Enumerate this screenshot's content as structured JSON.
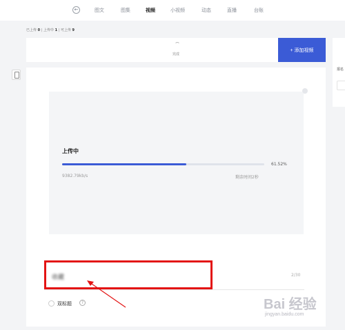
{
  "nav": {
    "back_icon": "back-arrow-icon",
    "items": [
      {
        "label": "图文",
        "active": false
      },
      {
        "label": "图集",
        "active": false
      },
      {
        "label": "视频",
        "active": true
      },
      {
        "label": "小视频",
        "active": false
      },
      {
        "label": "动态",
        "active": false
      },
      {
        "label": "直播",
        "active": false
      },
      {
        "label": "台账",
        "active": false
      }
    ]
  },
  "counters": {
    "uploaded_label": "已上传",
    "uploaded": "0",
    "sep": " | ",
    "uploading_label": "上传中",
    "uploading": "1",
    "available_label": "可上传",
    "available": "9"
  },
  "header": {
    "label": "完成",
    "add_button": "+ 添加视频"
  },
  "side": {
    "label": "报名"
  },
  "upload": {
    "title": "上传中",
    "progress": 0.6152,
    "percent": "61.52%",
    "speed": "9382.79kb/s",
    "remaining": "剩余时间2秒",
    "accent": "#3b5bd6"
  },
  "form": {
    "title_value": "收藏",
    "title_count": "2/30",
    "double_title_label": "双标题",
    "help_icon": "question-circle-icon"
  },
  "annotation": {
    "highlight_color": "#e31313"
  },
  "watermark": {
    "brand": "Bai 经验",
    "url": "jingyan.baidu.com"
  }
}
